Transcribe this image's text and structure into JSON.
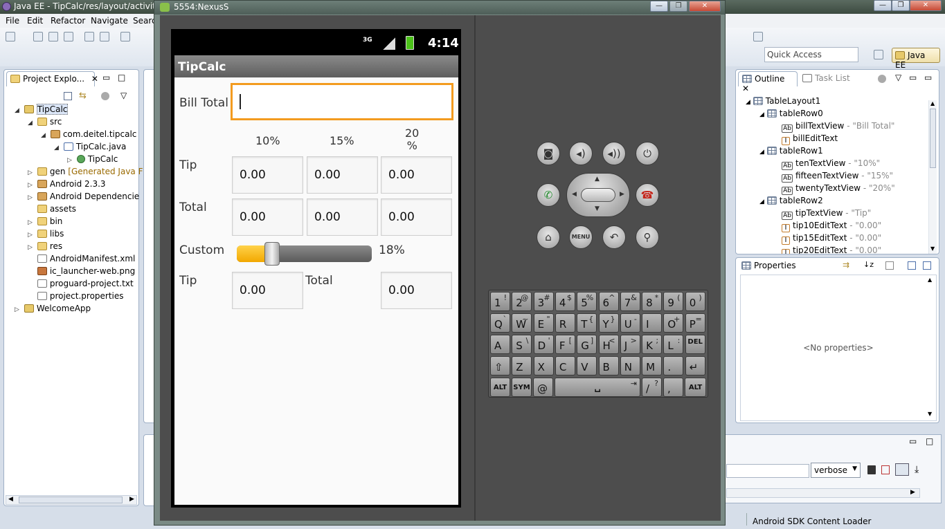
{
  "eclipse": {
    "title": "Java EE - TipCalc/res/layout/activity_ti",
    "menu": [
      "File",
      "Edit",
      "Refactor",
      "Navigate",
      "Searc"
    ],
    "quick_access": "Quick Access",
    "perspective": "Java EE",
    "status_text": "Android SDK Content Loader"
  },
  "project_explorer": {
    "tab_label": "Project Explo...",
    "items": [
      {
        "label": "TipCalc",
        "suffix": ""
      },
      {
        "label": "src",
        "suffix": ""
      },
      {
        "label": "com.deitel.tipcalc",
        "suffix": ""
      },
      {
        "label": "TipCalc.java",
        "suffix": ""
      },
      {
        "label": "TipCalc",
        "suffix": ""
      },
      {
        "label": "gen",
        "suffix": "[Generated Java F"
      },
      {
        "label": "Android 2.3.3",
        "suffix": ""
      },
      {
        "label": "Android Dependencie",
        "suffix": ""
      },
      {
        "label": "assets",
        "suffix": ""
      },
      {
        "label": "bin",
        "suffix": ""
      },
      {
        "label": "libs",
        "suffix": ""
      },
      {
        "label": "res",
        "suffix": ""
      },
      {
        "label": "AndroidManifest.xml",
        "suffix": ""
      },
      {
        "label": "ic_launcher-web.png",
        "suffix": ""
      },
      {
        "label": "proguard-project.txt",
        "suffix": ""
      },
      {
        "label": "project.properties",
        "suffix": ""
      },
      {
        "label": "WelcomeApp",
        "suffix": ""
      }
    ]
  },
  "emulator": {
    "window_title": "5554:NexusS",
    "status_time": "4:14",
    "network": "3G",
    "app": {
      "title": "TipCalc",
      "bill_label": "Bill Total",
      "bill_value": "",
      "headers": [
        "10%",
        "15%",
        "20\n%"
      ],
      "tip_label": "Tip",
      "total_label": "Total",
      "tip_values": [
        "0.00",
        "0.00",
        "0.00"
      ],
      "total_values": [
        "0.00",
        "0.00",
        "0.00"
      ],
      "custom_label": "Custom",
      "custom_percent_text": "18%",
      "custom_percent": 18,
      "custom_tip_label": "Tip",
      "custom_tip_value": "0.00",
      "custom_total_label": "Total",
      "custom_total_value": "0.00"
    },
    "controls": {
      "menu_label": "MENU"
    },
    "keyboard": {
      "rows": [
        [
          {
            "m": "1",
            "a": "!"
          },
          {
            "m": "2",
            "a": "@"
          },
          {
            "m": "3",
            "a": "#"
          },
          {
            "m": "4",
            "a": "$"
          },
          {
            "m": "5",
            "a": "%"
          },
          {
            "m": "6",
            "a": "^"
          },
          {
            "m": "7",
            "a": "&"
          },
          {
            "m": "8",
            "a": "*"
          },
          {
            "m": "9",
            "a": "("
          },
          {
            "m": "0",
            "a": ")"
          }
        ],
        [
          {
            "m": "Q",
            "a": "`"
          },
          {
            "m": "W",
            "a": "~"
          },
          {
            "m": "E",
            "a": "\""
          },
          {
            "m": "R",
            "a": ""
          },
          {
            "m": "T",
            "a": "{"
          },
          {
            "m": "Y",
            "a": "}"
          },
          {
            "m": "U",
            "a": "-"
          },
          {
            "m": "I",
            "a": ""
          },
          {
            "m": "O",
            "a": "+"
          },
          {
            "m": "P",
            "a": "="
          }
        ],
        [
          {
            "m": "A",
            "a": ""
          },
          {
            "m": "S",
            "a": "\\"
          },
          {
            "m": "D",
            "a": "'"
          },
          {
            "m": "F",
            "a": "["
          },
          {
            "m": "G",
            "a": "]"
          },
          {
            "m": "H",
            "a": "<"
          },
          {
            "m": "J",
            "a": ">"
          },
          {
            "m": "K",
            "a": ";"
          },
          {
            "m": "L",
            "a": ":"
          },
          {
            "m": "",
            "a": "",
            "s": "DEL"
          }
        ],
        [
          {
            "m": "⇧",
            "a": ""
          },
          {
            "m": "Z",
            "a": ""
          },
          {
            "m": "X",
            "a": ""
          },
          {
            "m": "C",
            "a": ""
          },
          {
            "m": "V",
            "a": ""
          },
          {
            "m": "B",
            "a": ""
          },
          {
            "m": "N",
            "a": ""
          },
          {
            "m": "M",
            "a": ""
          },
          {
            "m": ".",
            "a": ""
          },
          {
            "m": "↵",
            "a": ""
          }
        ]
      ],
      "bottom": {
        "alt_left": "ALT",
        "sym": "SYM",
        "at": "@",
        "space": "␣",
        "slash": "/",
        "question": "?",
        "comma": ",",
        "alt_right": "ALT"
      }
    }
  },
  "outline": {
    "tab_label": "Outline",
    "tasklist_label": "Task List",
    "items": [
      {
        "label": "TableLayout1",
        "detail": ""
      },
      {
        "label": "tableRow0",
        "detail": ""
      },
      {
        "label": "billTextView",
        "detail": " - \"Bill Total\""
      },
      {
        "label": "billEditText",
        "detail": ""
      },
      {
        "label": "tableRow1",
        "detail": ""
      },
      {
        "label": "tenTextView",
        "detail": " - \"10%\""
      },
      {
        "label": "fifteenTextView",
        "detail": " - \"15%\""
      },
      {
        "label": "twentyTextView",
        "detail": " - \"20%\""
      },
      {
        "label": "tableRow2",
        "detail": ""
      },
      {
        "label": "tipTextView",
        "detail": " - \"Tip\""
      },
      {
        "label": "tip10EditText",
        "detail": " - \"0.00\""
      },
      {
        "label": "tip15EditText",
        "detail": " - \"0.00\""
      },
      {
        "label": "tip20EditText",
        "detail": " - \"0.00\""
      }
    ]
  },
  "properties": {
    "tab_label": "Properties",
    "empty_text": "<No properties>"
  },
  "console": {
    "log_level": "verbose"
  }
}
